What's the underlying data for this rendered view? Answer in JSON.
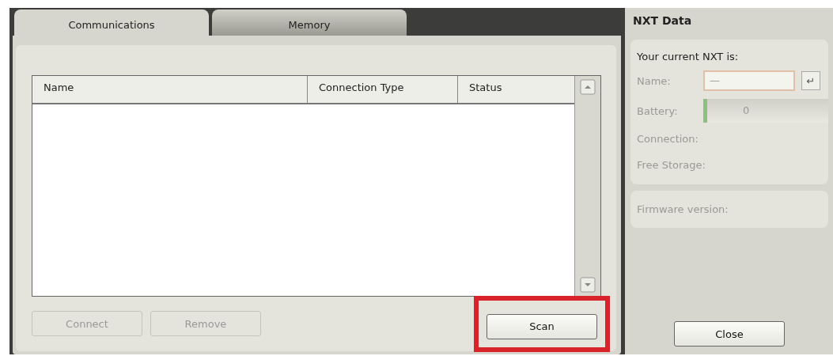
{
  "tabs": [
    {
      "label": "Communications",
      "selected": true
    },
    {
      "label": "Memory",
      "selected": false
    }
  ],
  "table": {
    "columns": [
      "Name",
      "Connection Type",
      "Status"
    ]
  },
  "left_buttons": [
    {
      "label": "Connect",
      "disabled": true,
      "highlighted": false
    },
    {
      "label": "Remove",
      "disabled": true,
      "highlighted": false
    },
    {
      "label": "Scan",
      "disabled": false,
      "highlighted": true
    }
  ],
  "nxt_data": {
    "title": "NXT Data",
    "heading": "Your current NXT is:",
    "name": {
      "label": "Name:",
      "value": "—",
      "enter_icon": "↵"
    },
    "battery": {
      "label": "Battery:",
      "level": 0.03,
      "reading": "0"
    },
    "connection_label": "Connection:",
    "storage_label": "Free Storage:",
    "firmware_label": "Firmware version:",
    "close_button": "Close"
  }
}
